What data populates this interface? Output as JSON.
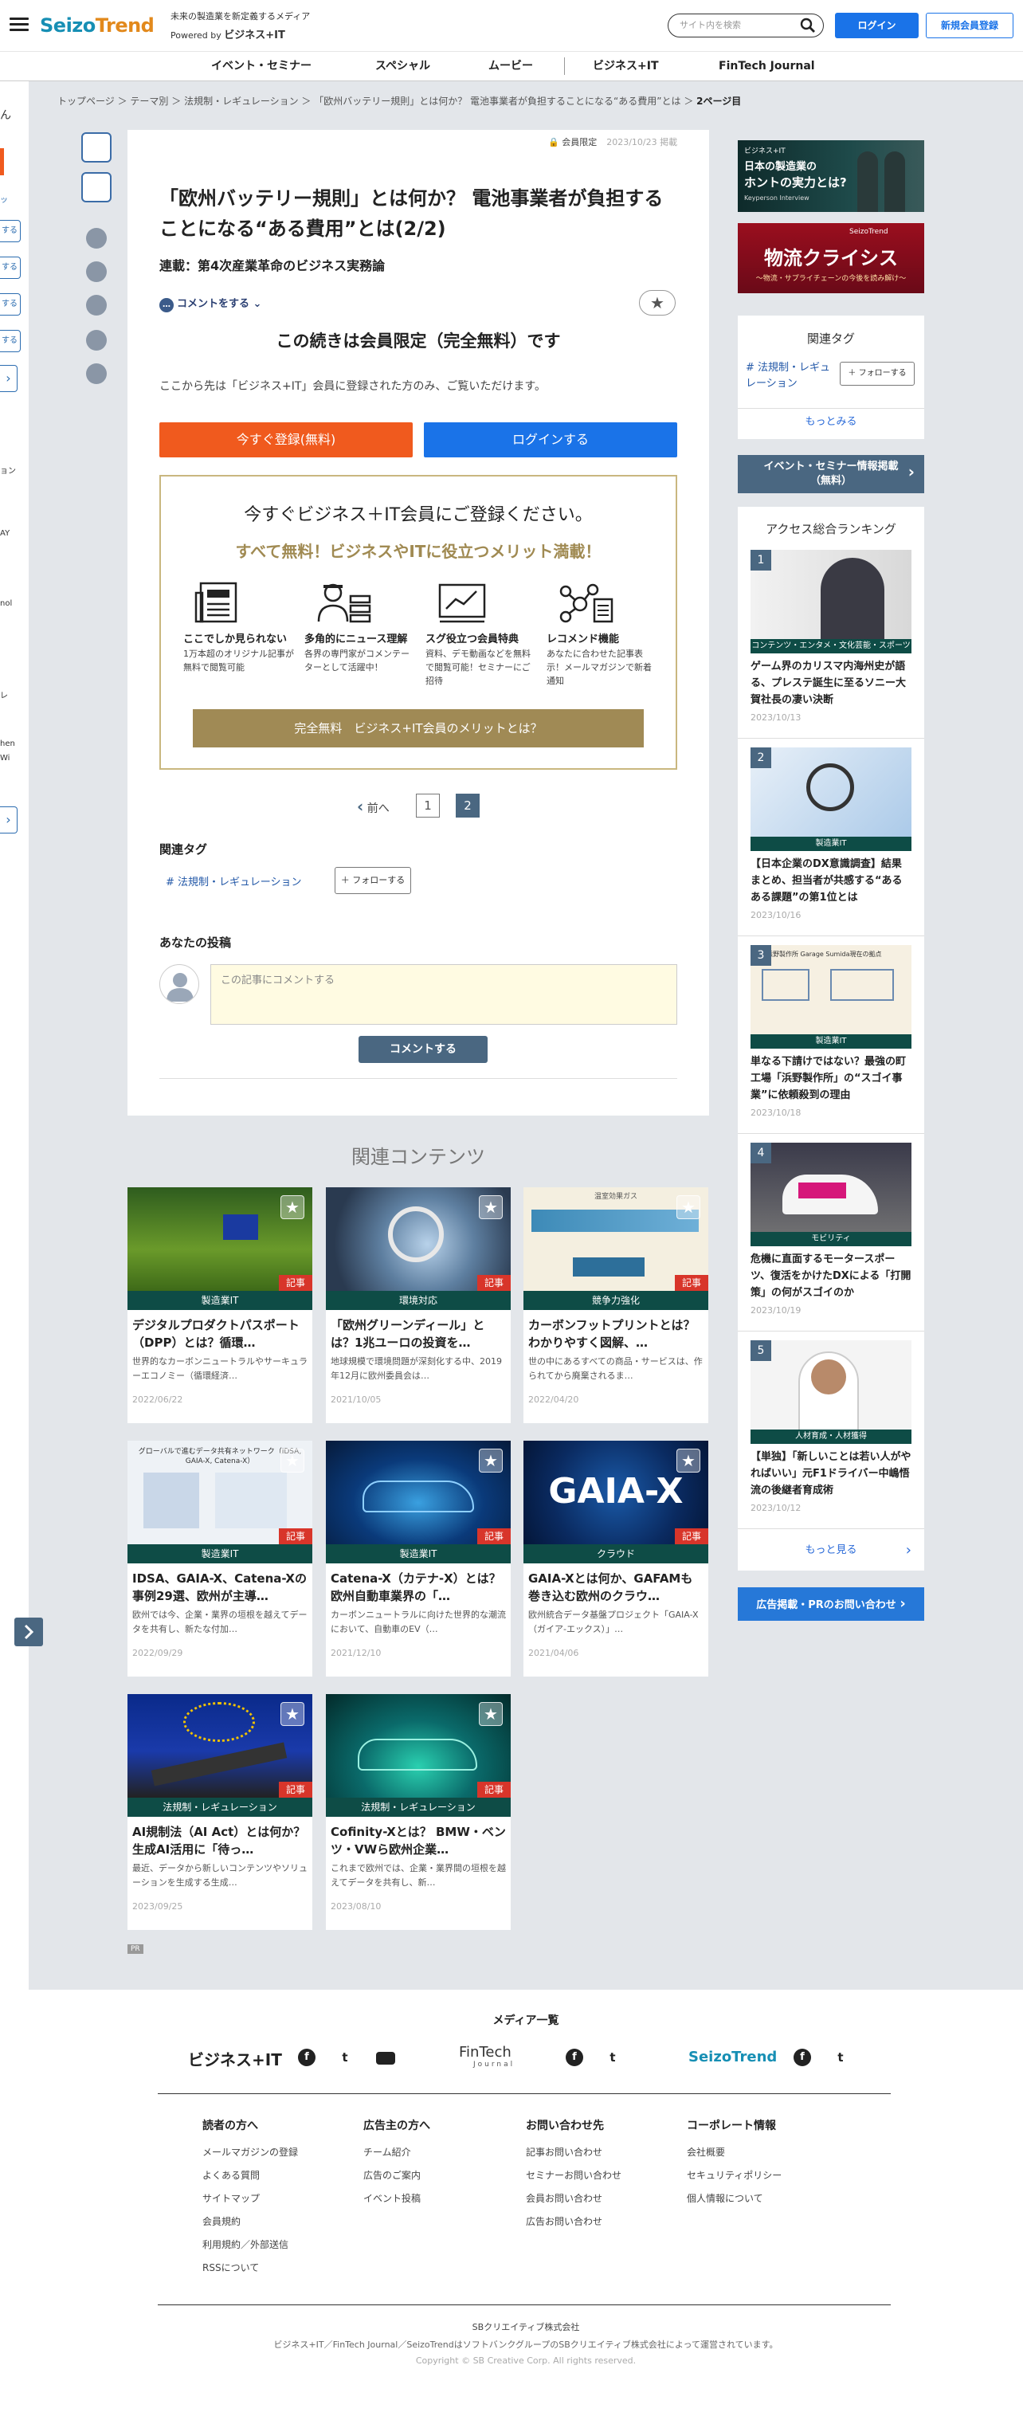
{
  "header": {
    "logo_main": "Seizo",
    "logo_sub": "Trend",
    "tagline": "未来の製造業を新定義するメディア",
    "powered": "Powered by",
    "powered_brand": "ビジネス+IT",
    "search_placeholder": "サイト内を検索",
    "login": "ログイン",
    "register": "新規会員登録"
  },
  "nav": [
    "イベント・セミナー",
    "スペシャル",
    "ムービー",
    "ビジネス+IT",
    "FinTech Journal"
  ],
  "left_strip": [
    "ん",
    "ッ",
    "する",
    "する",
    "する",
    "する",
    "ョン",
    "AY",
    "nol",
    "レ",
    "hen",
    "Wi"
  ],
  "breadcrumb": [
    "トップページ",
    "テーマ別",
    "法規制・レギュレーション",
    "「欧州バッテリー規則」とは何か？ 電池事業者が負担することになる“ある費用”とは"
  ],
  "breadcrumb_current": "2ページ目",
  "article": {
    "badge": "会員限定",
    "date": "2023/10/23 掲載",
    "title": "「欧州バッテリー規則」とは何か？ 電池事業者が負担することになる“ある費用”とは(2/2)",
    "series": "連載：第4次産業革命のビジネス実務論",
    "comment_link": "コメントをする",
    "lead": "この続きは会員限定（完全無料）です",
    "intro": "ここから先は「ビジネス+IT」会員に登録された方のみ、ご覧いただけます。",
    "btn_register": "今すぐ登録(無料)",
    "btn_login": "ログインする"
  },
  "promo": {
    "heading": "今すぐビジネス＋IT会員にご登録ください。",
    "subheading": "すべて無料！ビジネスやITに役立つメリット満載！",
    "features": [
      {
        "title": "ここでしか見られない",
        "desc": "1万本超のオリジナル記事が無料で閲覧可能"
      },
      {
        "title": "多角的にニュース理解",
        "desc": "各界の専門家がコメンテーターとして活躍中！"
      },
      {
        "title": "スグ役立つ会員特典",
        "desc": "資料、デモ動画などを無料で閲覧可能！セミナーにご招待"
      },
      {
        "title": "レコメンド機能",
        "desc": "あなたに合わせた記事表示！メールマガジンで新着通知"
      }
    ],
    "button": "完全無料　ビジネス+IT会員のメリットとは？"
  },
  "pager": {
    "prev": "前へ",
    "pages": [
      "1",
      "2"
    ],
    "current": "2"
  },
  "related_tags": {
    "heading": "関連タグ",
    "tag": "# 法規制・レギュレーション",
    "follow": "フォローする"
  },
  "post": {
    "heading": "あなたの投稿",
    "placeholder": "この記事にコメントする",
    "button": "コメントする"
  },
  "related": {
    "heading": "関連コンテンツ",
    "kiji": "記事",
    "items": [
      {
        "cat": "製造業IT",
        "title": "デジタルプロダクトパスポート（DPP）とは？循環…",
        "desc": "世界的なカーボンニュートラルやサーキュラーエコノミー（循環経済…",
        "date": "2022/06/22"
      },
      {
        "cat": "環境対応",
        "title": "「欧州グリーンディール」とは？1兆ユーロの投資を…",
        "desc": "地球規模で環境問題が深刻化する中、2019年12月に欧州委員会は…",
        "date": "2021/10/05"
      },
      {
        "cat": "競争力強化",
        "title": "カーボンフットプリントとは？わかりやすく図解、…",
        "desc": "世の中にあるすべての商品・サービスは、作られてから廃棄されるま…",
        "date": "2022/04/20"
      },
      {
        "cat": "製造業IT",
        "title": "IDSA、GAIA-X、Catena-Xの事例29選、欧州が主導…",
        "desc": "欧州では今、企業・業界の垣根を越えてデータを共有し、新たな付加…",
        "date": "2022/09/29"
      },
      {
        "cat": "製造業IT",
        "title": "Catena-X（カテナ-X）とは？ 欧州自動車業界の「…",
        "desc": "カーボンニュートラルに向けた世界的な潮流において、自動車のEV（…",
        "date": "2021/12/10"
      },
      {
        "cat": "クラウド",
        "title": "GAIA-Xとは何か、GAFAMも巻き込む欧州のクラウ…",
        "desc": "欧州統合データ基盤プロジェクト「GAIA-X（ガイア-エックス）」…",
        "date": "2021/04/06"
      },
      {
        "cat": "法規制・レギュレーション",
        "title": "AI規制法（AI Act）とは何か？ 生成AI活用に「待っ…",
        "desc": "最近、データから新しいコンテンツやソリューションを生成する生成…",
        "date": "2023/09/25"
      },
      {
        "cat": "法規制・レギュレーション",
        "title": "Cofinity-Xとは？ BMW・ベンツ・VWら欧州企業…",
        "desc": "これまで欧州では、企業・業界間の垣根を越えてデータを共有し、新…",
        "date": "2023/08/10"
      }
    ],
    "img_texts": {
      "gaia": "GAIA-X",
      "cfp": "温室効果ガス",
      "idsa": "グローバルで進むデータ共有ネットワーク（IDSA, GAIA-X, Catena-X）"
    }
  },
  "pr": "PR",
  "sidebar": {
    "banner1": {
      "brand": "ビジネス+IT",
      "line1": "日本の製造業の",
      "line2": "ホントの実力とは?",
      "line3": "Keyperson Interview"
    },
    "banner2": {
      "brand": "SeizoTrend",
      "line1": "物流クライシス",
      "line2": "〜物流・サプライチェーンの今後を読み解け〜"
    },
    "tags_heading": "関連タグ",
    "tag": "# 法規制・レギュレーション",
    "follow": "フォローする",
    "more_tags": "もっとみる",
    "event_btn": "イベント・セミナー情報掲載（無料）",
    "ranking_heading": "アクセス総合ランキング",
    "ranking": [
      {
        "n": "1",
        "cat": "コンテンツ・エンタメ・文化芸能・スポーツ",
        "title": "ゲーム界のカリスマ内海州史が語る、プレステ誕生に至るソニー大賀社長の凄い決断",
        "date": "2023/10/13"
      },
      {
        "n": "2",
        "cat": "製造業IT",
        "title": "【日本企業のDX意識調査】結果まとめ、担当者が共感する“あるある課題”の第1位とは",
        "date": "2023/10/16"
      },
      {
        "n": "3",
        "cat": "製造業IT",
        "title": "単なる下請けではない？最強の町工場「浜野製作所」の“スゴイ事業”に依頼殺到の理由",
        "date": "2023/10/18"
      },
      {
        "n": "4",
        "cat": "モビリティ",
        "title": "危機に直面するモータースポーツ、復活をかけたDXによる「打開策」の何がスゴイのか",
        "date": "2023/10/19"
      },
      {
        "n": "5",
        "cat": "人材育成・人材獲得",
        "title": "【単独】「新しいことは若い人がやればいい」元F1ドライバー中嶋悟流の後継者育成術",
        "date": "2023/10/12"
      }
    ],
    "rank3_img_text": "浜野製作所 Garage Sumida現在の拠点",
    "more": "もっと見る",
    "ad_btn": "広告掲載・PRのお問い合わせ"
  },
  "footer": {
    "media_heading": "メディア一覧",
    "brands": [
      "ビジネス+IT",
      "FinTech",
      "SeizoTrend"
    ],
    "fintech_sub": "Journal",
    "cols": [
      {
        "h": "読者の方へ",
        "items": [
          "メールマガジンの登録",
          "よくある質問",
          "サイトマップ",
          "会員規約",
          "利用規約／外部送信",
          "RSSについて"
        ]
      },
      {
        "h": "広告主の方へ",
        "items": [
          "チーム紹介",
          "広告のご案内",
          "イベント投稿"
        ]
      },
      {
        "h": "お問い合わせ先",
        "items": [
          "記事お問い合わせ",
          "セミナーお問い合わせ",
          "会員お問い合わせ",
          "広告お問い合わせ"
        ]
      },
      {
        "h": "コーポレート情報",
        "items": [
          "会社概要",
          "セキュリティポリシー",
          "個人情報について"
        ]
      }
    ],
    "company": "SBクリエイティブ株式会社",
    "note": "ビジネス+IT／FinTech Journal／SeizoTrendはソフトバンクグループのSBクリエイティブ株式会社によって運営されています。",
    "copyright": "Copyright © SB Creative Corp. All rights reserved."
  },
  "colors": {
    "accent_blue": "#1a73e8",
    "register_orange": "#f05a1e",
    "gold": "#a08a52",
    "slate": "#4a6781",
    "category_green": "#0e4c46",
    "badge_red": "#d8352a"
  }
}
